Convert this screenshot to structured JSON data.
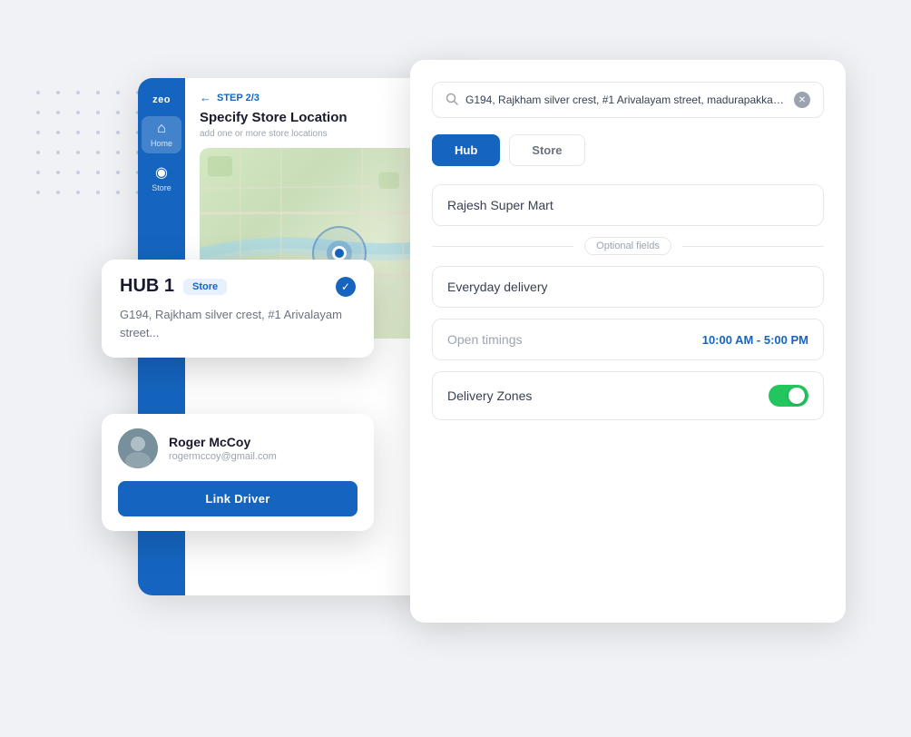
{
  "background": {
    "dots_count": 48
  },
  "sidebar": {
    "logo": "zeo",
    "items": [
      {
        "id": "home",
        "label": "Home",
        "icon": "⌂",
        "active": true
      },
      {
        "id": "store",
        "label": "Store",
        "icon": "◈",
        "active": false
      }
    ]
  },
  "back_panel": {
    "step": "STEP 2/3",
    "title": "Specify Store Location",
    "subtitle": "add one or more store locations"
  },
  "hub_card": {
    "title": "HUB 1",
    "badge": "Store",
    "address": "G194, Rajkham silver crest, #1 Arivalayam street..."
  },
  "driver_card": {
    "name": "Roger McCoy",
    "email": "rogermccoy@gmail.com",
    "link_button": "Link Driver"
  },
  "front_panel": {
    "search_value": "G194, Rajkham silver crest, #1 Arivalayam street, madurapakkam,...",
    "tabs": [
      {
        "id": "hub",
        "label": "Hub",
        "active": true
      },
      {
        "id": "store",
        "label": "Store",
        "active": false
      }
    ],
    "store_name_placeholder": "Rajesh Super Mart",
    "optional_label": "Optional fields",
    "description_placeholder": "Everyday delivery",
    "timings_label": "Open timings",
    "timings_value": "10:00 AM - 5:00 PM",
    "delivery_zones_label": "Delivery Zones",
    "delivery_zones_enabled": true
  }
}
